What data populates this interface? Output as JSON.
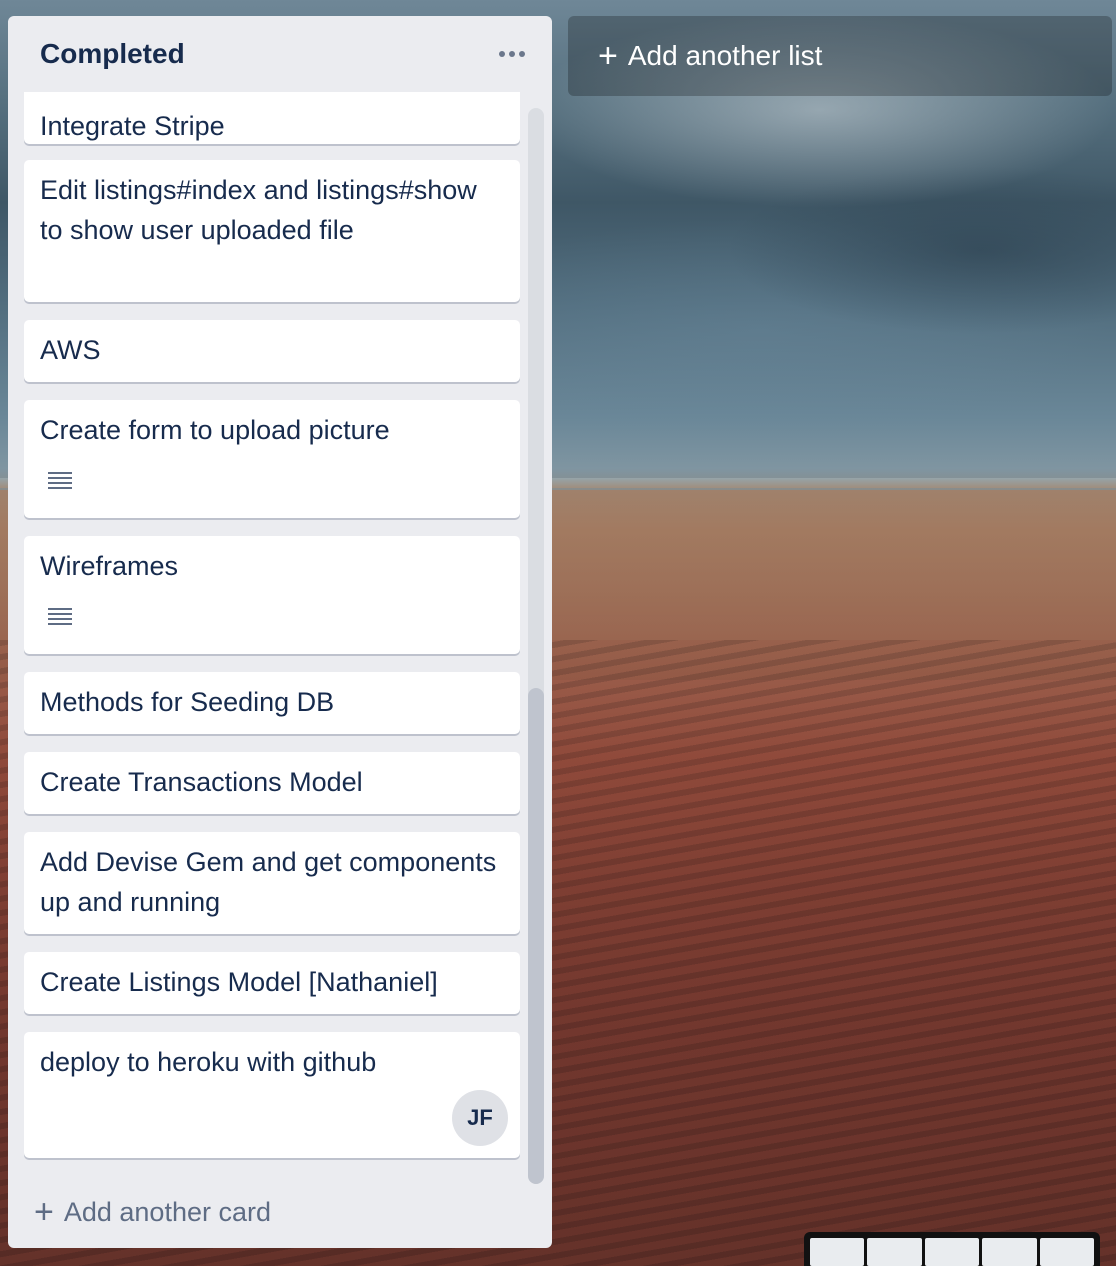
{
  "list": {
    "title": "Completed",
    "menu_icon": "ellipsis-icon",
    "add_card_label": "Add another card",
    "cards": [
      {
        "title": "Integrate Stripe"
      },
      {
        "title": "Edit listings#index and listings#show to show user uploaded file"
      },
      {
        "title": "AWS"
      },
      {
        "title": "Create form to upload picture",
        "has_description": true
      },
      {
        "title": "Wireframes",
        "has_description": true
      },
      {
        "title": "Methods for Seeding DB"
      },
      {
        "title": "Create Transactions Model"
      },
      {
        "title": "Add Devise Gem and get components up and running"
      },
      {
        "title": "Create Listings Model [Nathaniel]"
      },
      {
        "title": "deploy to heroku with github",
        "member": "JF"
      }
    ]
  },
  "add_list_label": "Add another list",
  "plus_symbol": "+"
}
